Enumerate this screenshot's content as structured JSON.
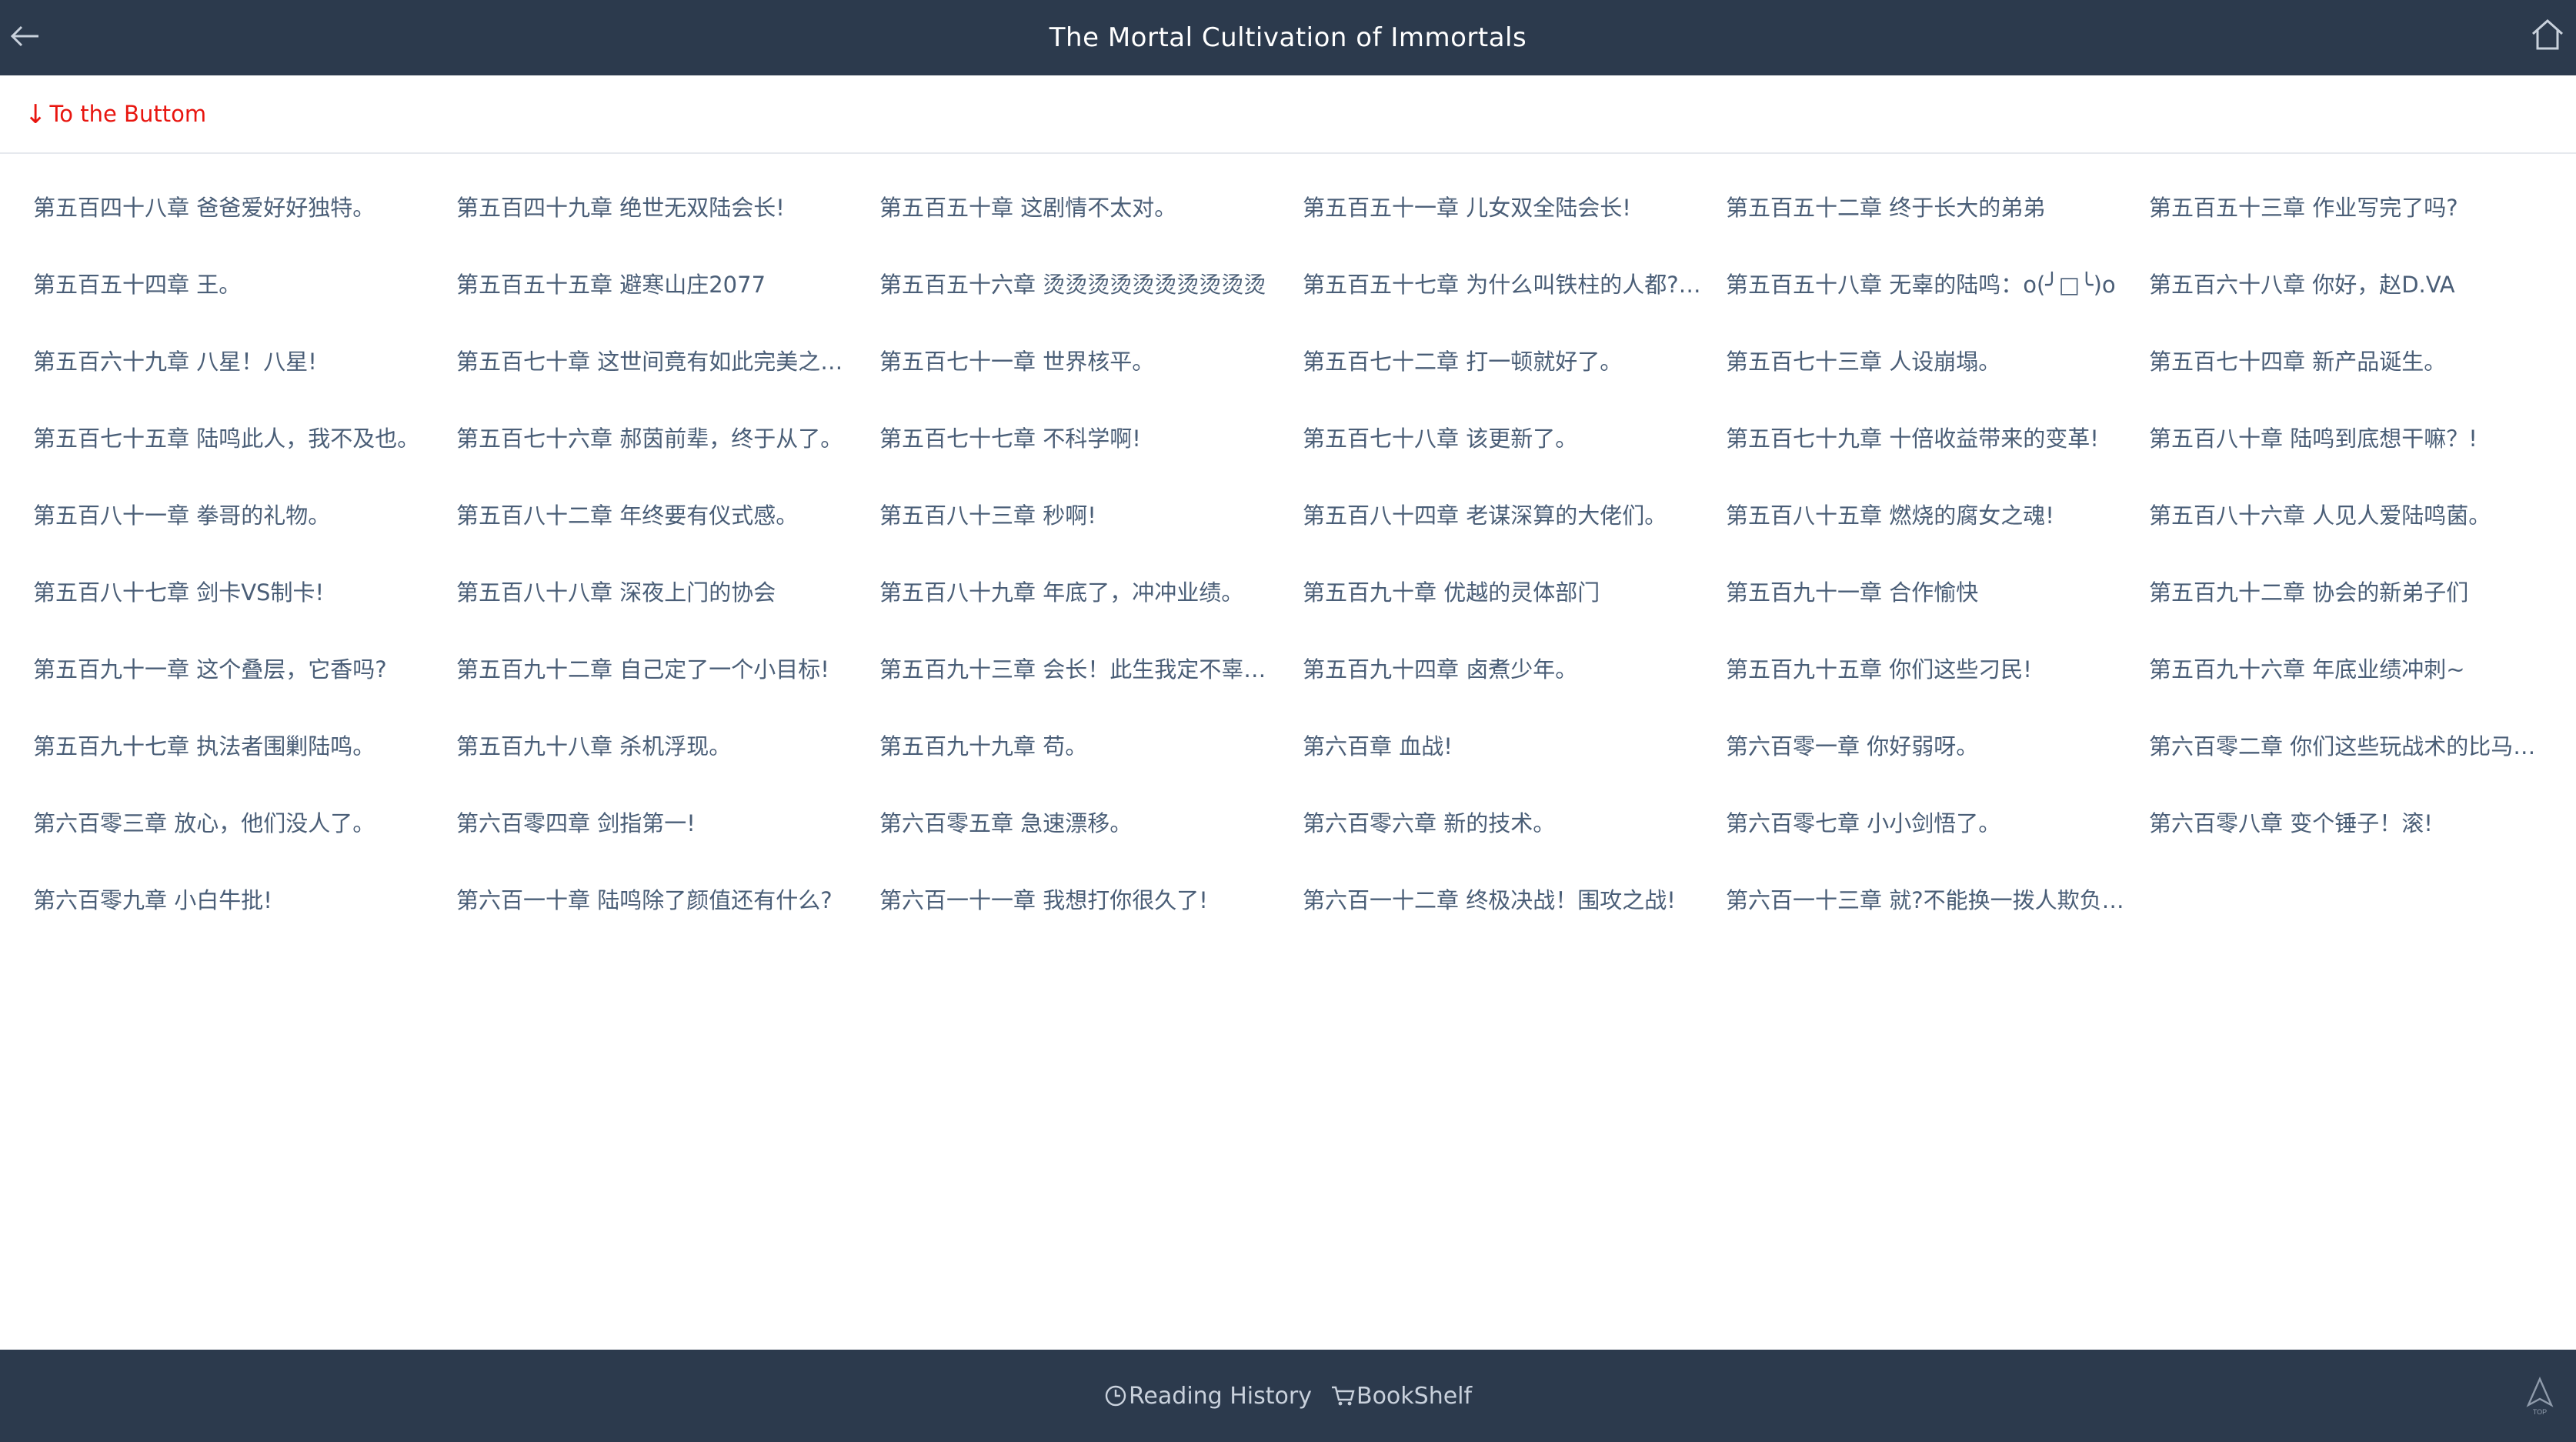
{
  "header": {
    "title": "The Mortal Cultivation of Immortals",
    "back_icon": "back-arrow-icon",
    "home_icon": "home-icon"
  },
  "to_bottom": {
    "arrow": "↓",
    "label": "To the Buttom",
    "color": "#e8150f"
  },
  "chapters": [
    "第五百四十八章 爸爸爱好好独特。",
    "第五百四十九章 绝世无双陆会长!",
    "第五百五十章 这剧情不太对。",
    "第五百五十一章 儿女双全陆会长!",
    "第五百五十二章 终于长大的弟弟",
    "第五百五十三章 作业写完了吗?",
    "第五百五十四章 王。",
    "第五百五十五章 避寒山庄2077",
    "第五百五十六章 烫烫烫烫烫烫烫烫烫烫",
    "第五百五十七章 为什么叫铁柱的人都?是…",
    "第五百五十八章 无辜的陆鸣：o(╯□╰)o",
    "第五百六十八章 你好，赵D.VA",
    "第五百六十九章 八星！八星!",
    "第五百七十章 这世间竟有如此完美之人…",
    "第五百七十一章 世界核平。",
    "第五百七十二章 打一顿就好了。",
    "第五百七十三章 人设崩塌。",
    "第五百七十四章 新产品诞生。",
    "第五百七十五章 陆鸣此人，我不及也。",
    "第五百七十六章 郝茵前辈，终于从了。",
    "第五百七十七章 不科学啊!",
    "第五百七十八章 该更新了。",
    "第五百七十九章 十倍收益带来的变革!",
    "第五百八十章 陆鸣到底想干嘛？!",
    "第五百八十一章 拳哥的礼物。",
    "第五百八十二章 年终要有仪式感。",
    "第五百八十三章 秒啊!",
    "第五百八十四章 老谋深算的大佬们。",
    "第五百八十五章 燃烧的腐女之魂!",
    "第五百八十六章 人见人爱陆鸣菌。",
    "第五百八十七章 剑卡VS制卡!",
    "第五百八十八章 深夜上门的协会",
    "第五百八十九章 年底了，冲冲业绩。",
    "第五百九十章 优越的灵体部门",
    "第五百九十一章 合作愉快",
    "第五百九十二章 协会的新弟子们",
    "第五百九十一章 这个叠层，它香吗?",
    "第五百九十二章 自己定了一个小目标!",
    "第五百九十三章 会长！此生我定不辜负…",
    "第五百九十四章 卤煮少年。",
    "第五百九十五章 你们这些刁民!",
    "第五百九十六章 年底业绩冲刺~",
    "第五百九十七章 执法者围剿陆鸣。",
    "第五百九十八章 杀机浮现。",
    "第五百九十九章 苟。",
    "第六百章 血战!",
    "第六百零一章 你好弱呀。",
    "第六百零二章 你们这些玩战术的比马桶…",
    "第六百零三章 放心，他们没人了。",
    "第六百零四章 剑指第一!",
    "第六百零五章 急速漂移。",
    "第六百零六章 新的技术。",
    "第六百零七章 小小剑悟了。",
    "第六百零八章 变个锤子！滚!",
    "第六百零九章 小白牛批!",
    "第六百一十章 陆鸣除了颜值还有什么?",
    "第六百一十一章 我想打你很久了!",
    "第六百一十二章 终极决战！围攻之战!",
    "第六百一十三章 就?不能换一拨人欺负么…"
  ],
  "footer": {
    "history_icon": "clock-icon",
    "history_label": "Reading History",
    "bookshelf_icon": "cart-icon",
    "bookshelf_label": "BookShelf",
    "top_icon": "back-to-top-icon",
    "top_label": "TOP"
  },
  "colors": {
    "bar_bg": "#2c3a4d",
    "chapter_text": "#4a5e77",
    "footer_text": "#c9d1dc"
  }
}
